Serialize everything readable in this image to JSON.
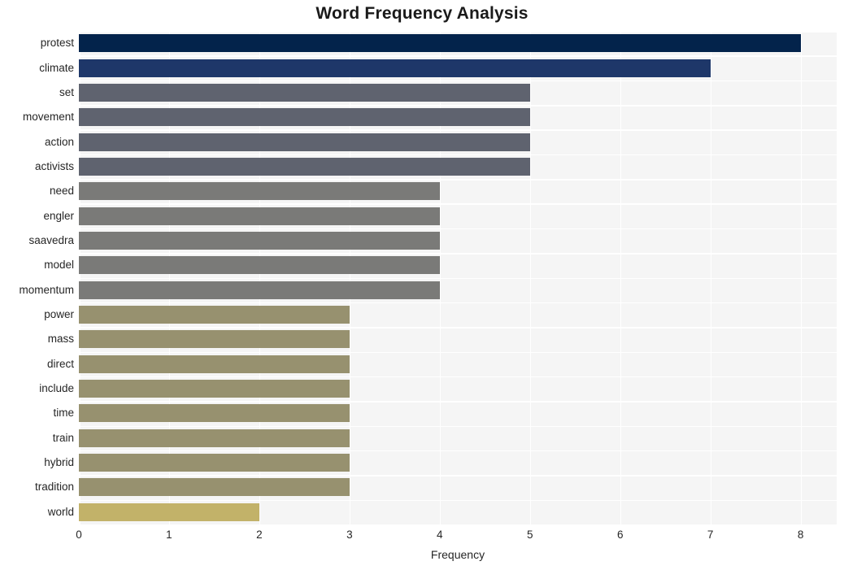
{
  "chart_data": {
    "type": "bar",
    "orientation": "horizontal",
    "title": "Word Frequency Analysis",
    "xlabel": "Frequency",
    "ylabel": "",
    "xlim": [
      0,
      8.4
    ],
    "xticks": [
      "0",
      "1",
      "2",
      "3",
      "4",
      "5",
      "6",
      "7",
      "8"
    ],
    "xtick_values": [
      0,
      1,
      2,
      3,
      4,
      5,
      6,
      7,
      8
    ],
    "grid": true,
    "legend": "none",
    "style": "whitegrid",
    "plot_background": "#f5f5f5",
    "grid_color": "#ffffff",
    "figure_background": "#ffffff",
    "categories": [
      "protest",
      "climate",
      "set",
      "movement",
      "action",
      "activists",
      "need",
      "engler",
      "saavedra",
      "model",
      "momentum",
      "power",
      "mass",
      "direct",
      "include",
      "time",
      "train",
      "hybrid",
      "tradition",
      "world"
    ],
    "values": [
      8,
      7,
      5,
      5,
      5,
      5,
      4,
      4,
      4,
      4,
      4,
      3,
      3,
      3,
      3,
      3,
      3,
      3,
      3,
      2
    ],
    "bar_colors": [
      "#03234b",
      "#1e3769",
      "#5f636f",
      "#5f636f",
      "#5f636f",
      "#5f636f",
      "#7a7a78",
      "#7a7a78",
      "#7a7a78",
      "#7a7a78",
      "#7a7a78",
      "#97916f",
      "#97916f",
      "#97916f",
      "#97916f",
      "#97916f",
      "#97916f",
      "#97916f",
      "#97916f",
      "#c2b269"
    ]
  }
}
